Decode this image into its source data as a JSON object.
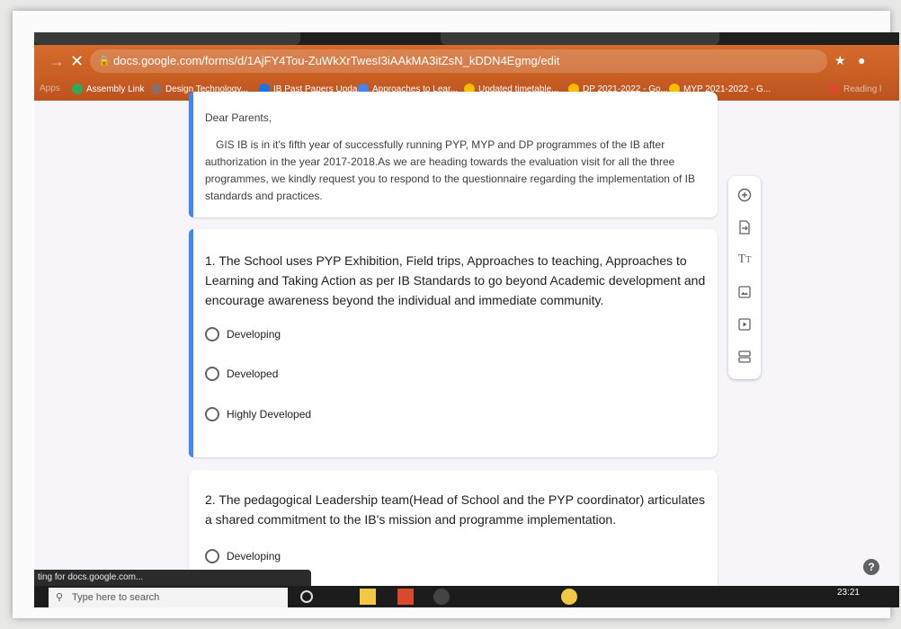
{
  "browser": {
    "url": "docs.google.com/forms/d/1AjFY4Tou-ZuWkXrTwesI3iAAkMA3itZsN_kDDN4Egmg/edit",
    "bookmarks": [
      {
        "label": "Apps",
        "color": "#4285f4"
      },
      {
        "label": "Assembly Link",
        "color": "#34a853"
      },
      {
        "label": "Design Technology...",
        "color": "#8d6e63"
      },
      {
        "label": "IB Past Papers Upda...",
        "color": "#1a73e8"
      },
      {
        "label": "Approaches to Lear...",
        "color": "#4285f4"
      },
      {
        "label": "Updated timetable...",
        "color": "#fbbc04"
      },
      {
        "label": "DP 2021-2022 - Go...",
        "color": "#fbbc04"
      },
      {
        "label": "MYP 2021-2022 - G...",
        "color": "#fbbc04"
      },
      {
        "label": "Reading l",
        "color": "#ea4335"
      }
    ],
    "status": "ting for docs.google.com..."
  },
  "form": {
    "description": {
      "greeting": "Dear Parents,",
      "body": "GIS IB is in it's fifth year of successfully running PYP, MYP and DP programmes of the IB after authorization in the year 2017-2018.As we are heading towards the evaluation visit for all the three programmes, we kindly request you to respond to the questionnaire regarding the implementation of IB standards and practices."
    },
    "questions": [
      {
        "title": "1. The School uses PYP Exhibition, Field trips, Approaches to teaching, Approaches to Learning and Taking Action as per IB Standards to go beyond Academic development and encourage awareness beyond the individual and immediate community.",
        "options": [
          "Developing",
          "Developed",
          "Highly Developed"
        ]
      },
      {
        "title": "2. The pedagogical Leadership team(Head of School and the PYP coordinator) articulates a shared commitment to the IB's mission and programme implementation.",
        "options": [
          "Developing"
        ]
      }
    ]
  },
  "toolbar": [
    "add-question-icon",
    "import-questions-icon",
    "add-title-icon",
    "add-image-icon",
    "add-video-icon",
    "add-section-icon"
  ],
  "taskbar": {
    "search_placeholder": "Type here to search",
    "time": "23:21"
  },
  "colors": {
    "accent": "#4285f4",
    "chrome": "#c85e22"
  }
}
